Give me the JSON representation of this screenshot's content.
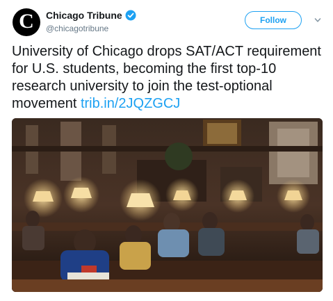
{
  "account": {
    "name": "Chicago Tribune",
    "handle": "@chicagotribune",
    "avatar_letter": "C",
    "verified_icon": "verified-badge-icon"
  },
  "actions": {
    "follow_label": "Follow",
    "more_icon": "chevron-down-icon"
  },
  "tweet": {
    "text": "University of Chicago drops SAT/ACT requirement for U.S. students, becoming the first top-10 research university to join the test-optional movement ",
    "link": "trib.in/2JQZGCJ"
  },
  "colors": {
    "accent": "#1da1f2",
    "text": "#14171a",
    "muted": "#657786"
  }
}
